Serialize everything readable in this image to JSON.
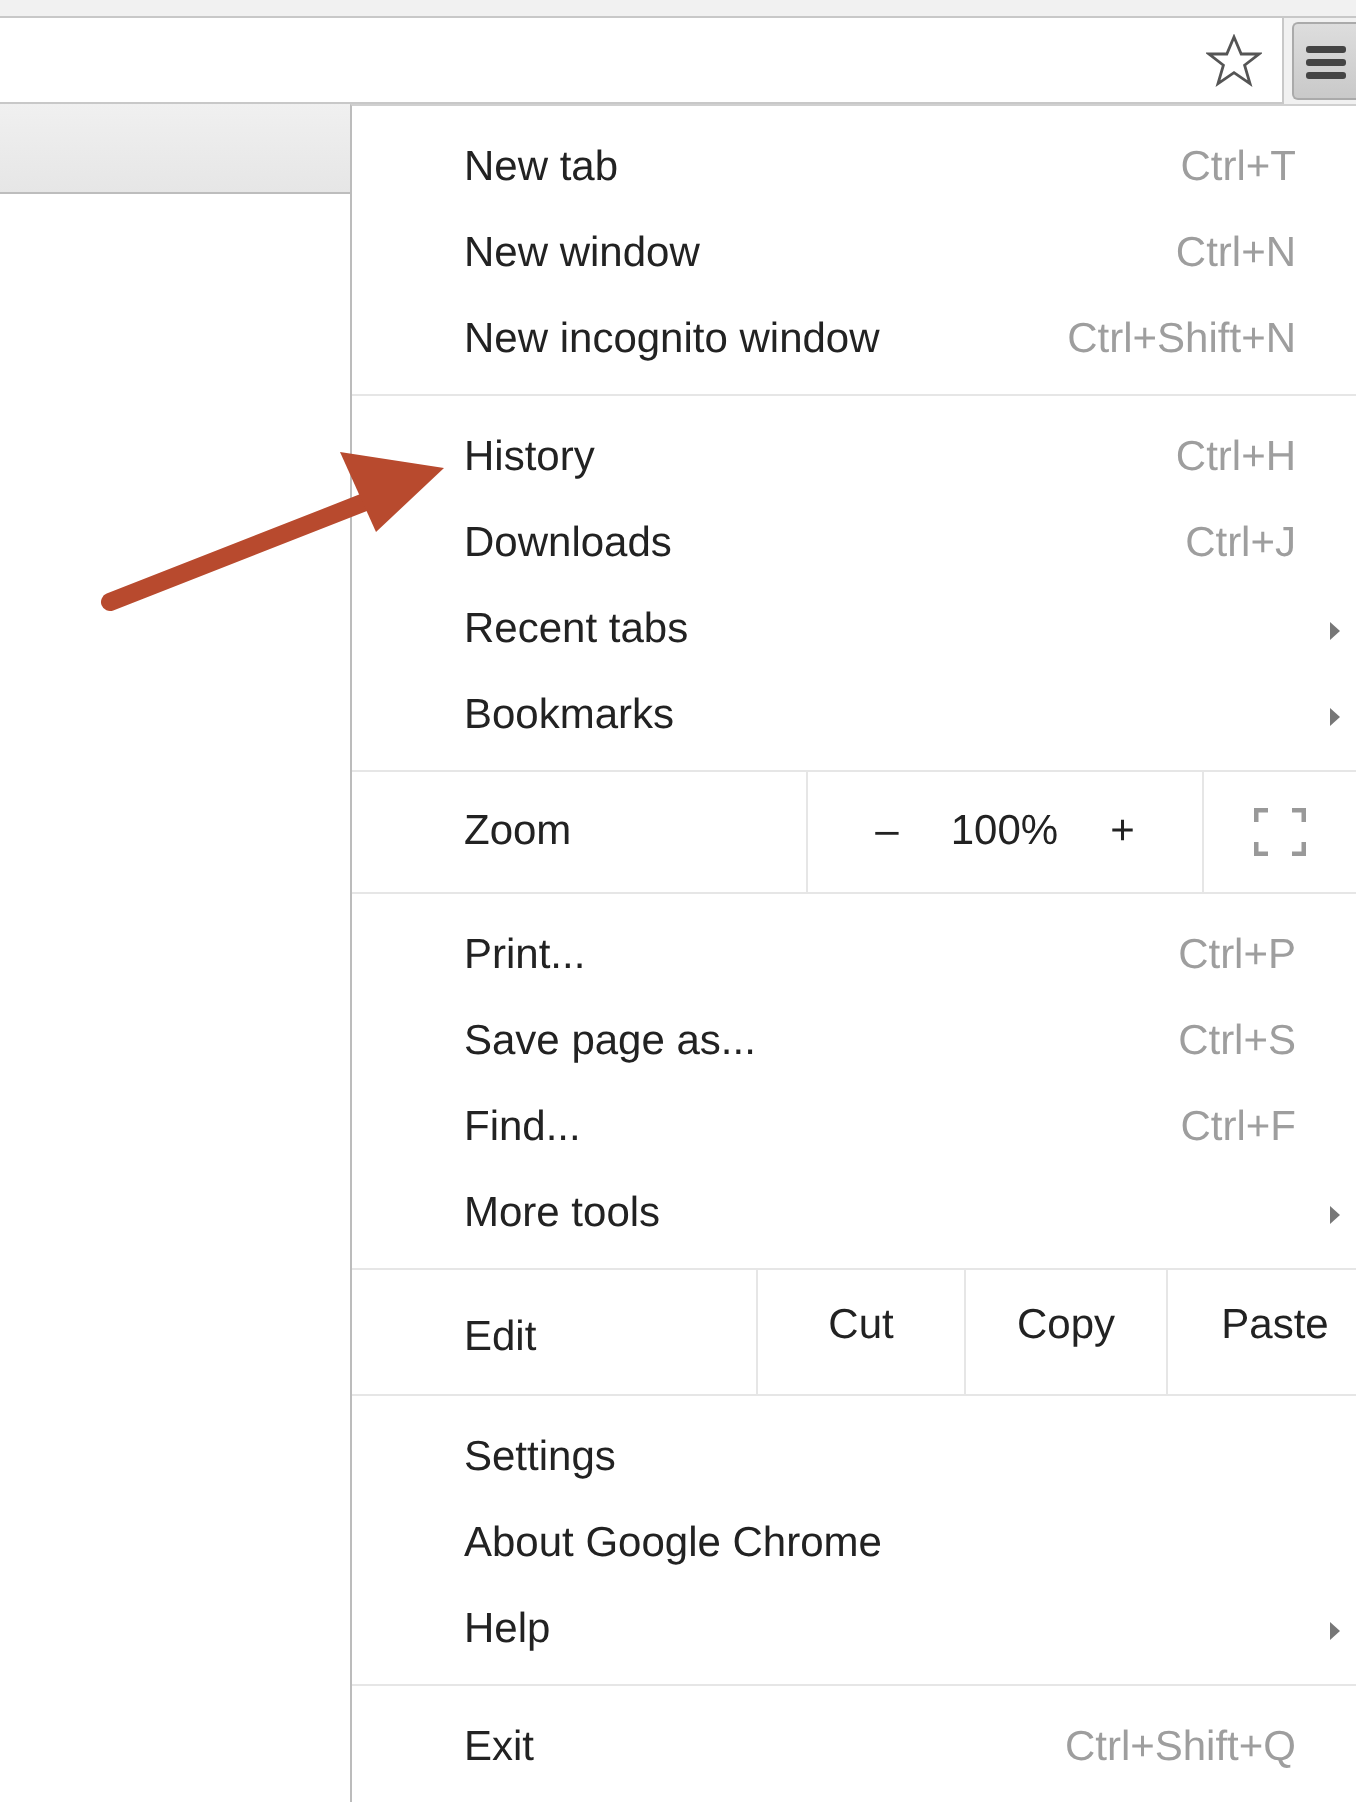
{
  "menu": {
    "sections": [
      {
        "kind": "items",
        "items": [
          {
            "label": "New tab",
            "shortcut": "Ctrl+T",
            "submenu": false
          },
          {
            "label": "New window",
            "shortcut": "Ctrl+N",
            "submenu": false
          },
          {
            "label": "New incognito window",
            "shortcut": "Ctrl+Shift+N",
            "submenu": false
          }
        ]
      },
      {
        "kind": "items",
        "items": [
          {
            "label": "History",
            "shortcut": "Ctrl+H",
            "submenu": false
          },
          {
            "label": "Downloads",
            "shortcut": "Ctrl+J",
            "submenu": false
          },
          {
            "label": "Recent tabs",
            "submenu": true
          },
          {
            "label": "Bookmarks",
            "submenu": true
          }
        ]
      },
      {
        "kind": "zoom",
        "label": "Zoom",
        "minus": "–",
        "value": "100%",
        "plus": "+"
      },
      {
        "kind": "items",
        "items": [
          {
            "label": "Print...",
            "shortcut": "Ctrl+P",
            "submenu": false
          },
          {
            "label": "Save page as...",
            "shortcut": "Ctrl+S",
            "submenu": false
          },
          {
            "label": "Find...",
            "shortcut": "Ctrl+F",
            "submenu": false
          },
          {
            "label": "More tools",
            "submenu": true
          }
        ]
      },
      {
        "kind": "edit",
        "label": "Edit",
        "actions": [
          "Cut",
          "Copy",
          "Paste"
        ]
      },
      {
        "kind": "items",
        "items": [
          {
            "label": "Settings",
            "submenu": false
          },
          {
            "label": "About Google Chrome",
            "submenu": false
          },
          {
            "label": "Help",
            "submenu": true
          }
        ]
      },
      {
        "kind": "items",
        "items": [
          {
            "label": "Exit",
            "shortcut": "Ctrl+Shift+Q",
            "submenu": false
          }
        ]
      }
    ]
  }
}
